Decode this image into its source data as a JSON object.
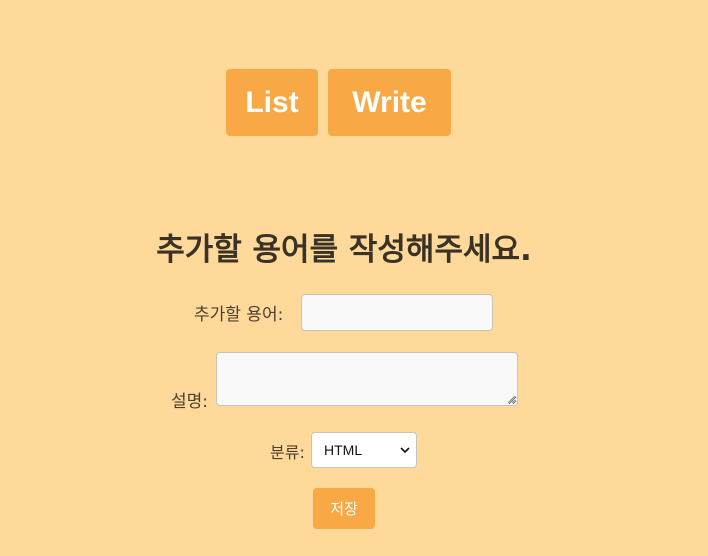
{
  "nav": {
    "list_label": "List",
    "write_label": "Write"
  },
  "form": {
    "heading": "추가할 용어를 작성해주세요.",
    "term_label": "추가할 용어:",
    "term_value": "",
    "description_label": "설명:",
    "description_value": "",
    "category_label": "분류:",
    "category_selected": "HTML",
    "save_label": "저장"
  },
  "colors": {
    "background": "#fed99a",
    "accent": "#f8a946",
    "button_text": "#ffffff"
  }
}
